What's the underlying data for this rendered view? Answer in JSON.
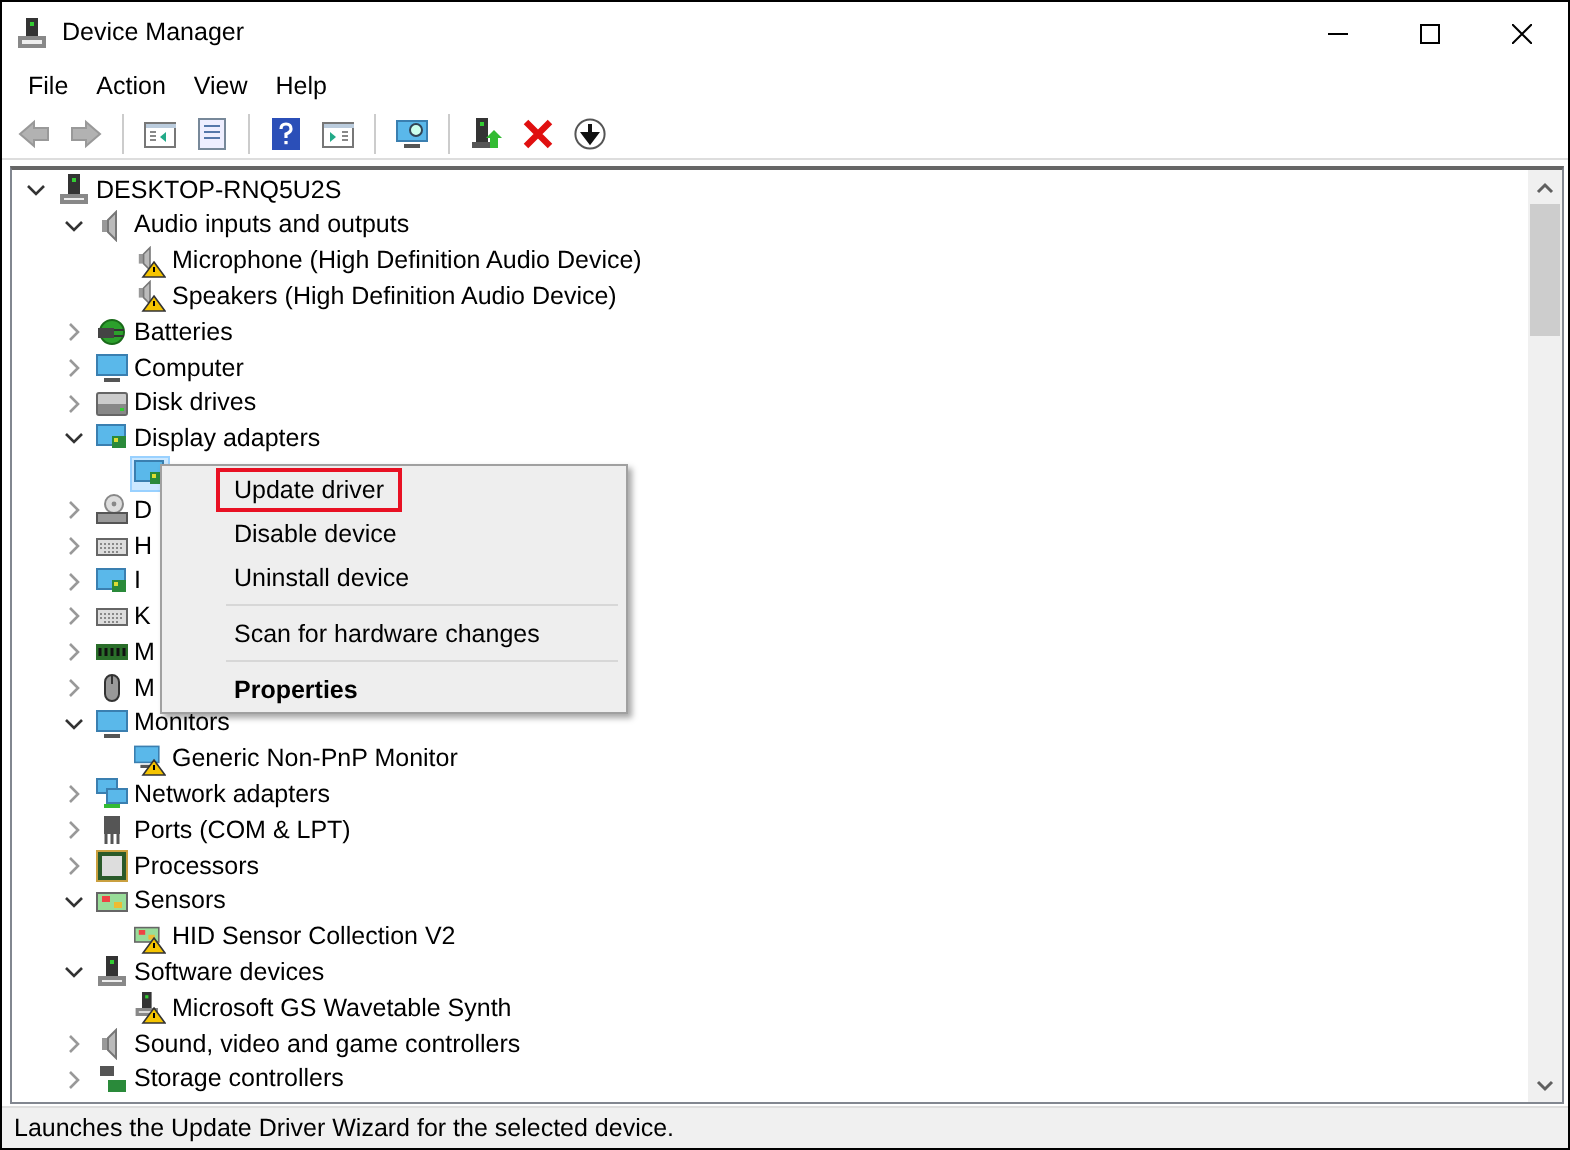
{
  "window": {
    "title": "Device Manager"
  },
  "menu": [
    "File",
    "Action",
    "View",
    "Help"
  ],
  "toolbar": [
    {
      "kind": "back",
      "disabled": true
    },
    {
      "kind": "forward",
      "disabled": true
    },
    {
      "kind": "sep"
    },
    {
      "kind": "panel",
      "disabled": false
    },
    {
      "kind": "sheet",
      "disabled": false
    },
    {
      "kind": "sep"
    },
    {
      "kind": "help",
      "disabled": false
    },
    {
      "kind": "panel2",
      "disabled": false
    },
    {
      "kind": "sep"
    },
    {
      "kind": "scan",
      "disabled": false
    },
    {
      "kind": "sep"
    },
    {
      "kind": "update",
      "disabled": false
    },
    {
      "kind": "remove",
      "disabled": false
    },
    {
      "kind": "down",
      "disabled": false
    }
  ],
  "tree": [
    {
      "label": "DESKTOP-RNQ5U2S",
      "kind": "computer",
      "expanded": true,
      "selected": false,
      "children": [
        {
          "label": "Audio inputs and outputs",
          "kind": "speaker",
          "expanded": true,
          "selected": false,
          "children": [
            {
              "label": "Microphone (High Definition Audio Device)",
              "kind": "speaker",
              "warning": true,
              "selected": false
            },
            {
              "label": "Speakers (High Definition Audio Device)",
              "kind": "speaker",
              "warning": true,
              "selected": false
            }
          ]
        },
        {
          "label": "Batteries",
          "kind": "battery",
          "expanded": false,
          "selected": false
        },
        {
          "label": "Computer",
          "kind": "monitor",
          "expanded": false,
          "selected": false
        },
        {
          "label": "Disk drives",
          "kind": "disk",
          "expanded": false,
          "selected": false
        },
        {
          "label": "Display adapters",
          "kind": "display",
          "expanded": true,
          "selected": false,
          "children": [
            {
              "kind": "display",
              "warning": false,
              "selected": true
            }
          ]
        },
        {
          "label": "D",
          "kind": "dvd",
          "expanded": false,
          "selected": false
        },
        {
          "label": "H",
          "kind": "keyboard",
          "expanded": false,
          "selected": false
        },
        {
          "label": "I",
          "kind": "display",
          "expanded": false,
          "selected": false
        },
        {
          "label": "K",
          "kind": "keyboard",
          "expanded": false,
          "selected": false
        },
        {
          "label": "M",
          "kind": "memory",
          "expanded": false,
          "selected": false
        },
        {
          "label": "M",
          "kind": "mouse",
          "expanded": false,
          "selected": false
        },
        {
          "label": "Monitors",
          "kind": "monitor",
          "expanded": true,
          "selected": false,
          "children": [
            {
              "label": "Generic Non-PnP Monitor",
              "kind": "monitor",
              "warning": true,
              "selected": false
            }
          ]
        },
        {
          "label": "Network adapters",
          "kind": "network",
          "expanded": false,
          "selected": false
        },
        {
          "label": "Ports (COM & LPT)",
          "kind": "port",
          "expanded": false,
          "selected": false
        },
        {
          "label": "Processors",
          "kind": "cpu",
          "expanded": false,
          "selected": false
        },
        {
          "label": "Sensors",
          "kind": "sensor",
          "expanded": true,
          "selected": false,
          "children": [
            {
              "label": "HID Sensor Collection V2",
              "kind": "sensor",
              "warning": true,
              "selected": false
            }
          ]
        },
        {
          "label": "Software devices",
          "kind": "computer",
          "expanded": true,
          "selected": false,
          "children": [
            {
              "label": "Microsoft GS Wavetable Synth",
              "kind": "computer",
              "warning": true,
              "selected": false
            }
          ]
        },
        {
          "label": "Sound, video and game controllers",
          "kind": "speaker",
          "expanded": false,
          "selected": false
        },
        {
          "label": "Storage controllers",
          "kind": "storage",
          "expanded": false,
          "selected": false
        }
      ]
    }
  ],
  "context_menu": [
    {
      "kind": "item",
      "label": "Update driver",
      "highlighted": true,
      "bold": false
    },
    {
      "kind": "item",
      "label": "Disable device",
      "highlighted": false,
      "bold": false
    },
    {
      "kind": "item",
      "label": "Uninstall device",
      "highlighted": false,
      "bold": false
    },
    {
      "kind": "separator"
    },
    {
      "kind": "item",
      "label": "Scan for hardware changes",
      "highlighted": false,
      "bold": false
    },
    {
      "kind": "separator"
    },
    {
      "kind": "item",
      "label": "Properties",
      "highlighted": false,
      "bold": true
    }
  ],
  "status_bar": "Launches the Update Driver Wizard for the selected device."
}
